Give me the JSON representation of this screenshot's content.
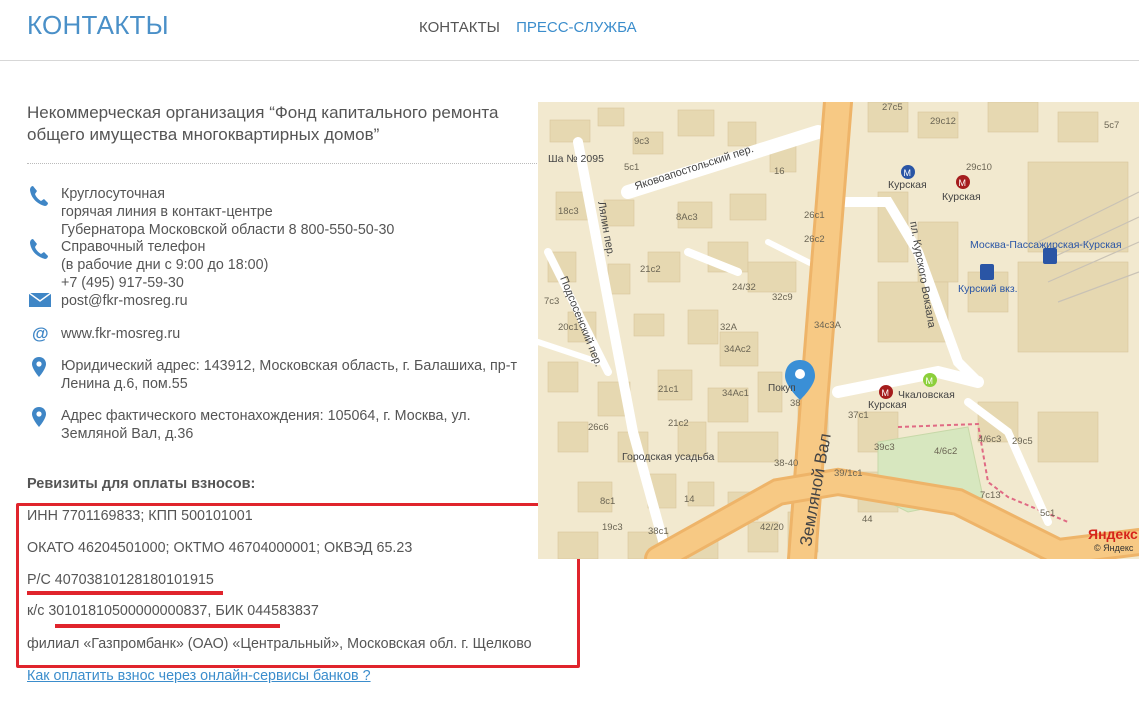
{
  "header": {
    "title": "КОНТАКТЫ",
    "nav": [
      "КОНТАКТЫ",
      "ПРЕСС-СЛУЖБА"
    ]
  },
  "organization": "Некоммерческая организация “Фонд капитального ремонта общего имущества многоквартирных домов”",
  "contacts": {
    "hotline": {
      "line1": "Круглосуточная",
      "line2": "горячая линия в контакт-центре",
      "line3": "Губернатора Московской области 8 800-550-50-30"
    },
    "reference": {
      "line1": "Справочный телефон",
      "line2": "(в рабочие дни с 9:00 до 18:00)",
      "line3": "+7 (495) 917-59-30"
    },
    "email": "post@fkr-mosreg.ru",
    "website": "www.fkr-mosreg.ru",
    "legal_address": "Юридический адрес: 143912, Московская область, г. Балашиха, пр-т Ленина д.6, пом.55",
    "actual_address": "Адрес фактического местонахождения: 105064, г. Москва, ул. Земляной Вал, д.36"
  },
  "requisites": {
    "title": "Ревизиты для оплаты взносов:",
    "inn": "ИНН 7701169833; КПП 500101001",
    "okato": "ОКАТО 46204501000; ОКТМО 46704000001; ОКВЭД 65.23",
    "rs": "Р/С 40703810128180101915",
    "ks": "к/с 30101810500000000837, БИК 044583837",
    "branch": "филиал «Газпромбанк» (ОАО) «Центральный», Московская обл. г. Щелково"
  },
  "pay_link": "Как оплатить взнос через онлайн-сервисы банков ?",
  "map": {
    "streets": {
      "zemlyanoy": "Земляной Вал",
      "yakovo": "Яковоапостольский пер.",
      "lyalin": "Лялин пер.",
      "podsosensky": "Подсосенский пер.",
      "kurskogo": "пл. Курского Вокзала"
    },
    "metro": {
      "kurskaya1": "Курская",
      "kurskaya2": "Курская",
      "kurskaya3": "Курская",
      "chkalovskaya": "Чкаловская"
    },
    "places": {
      "passenger": "Москва-Пассажирская-Курская",
      "kursky_vkz": "Курский вкз.",
      "usadba": "Городская усадьба",
      "school": "Ша № 2095",
      "pokr": "Покуп"
    },
    "houses": [
      "27с5",
      "29с12",
      "5с7",
      "9с3",
      "5с1",
      "29с10",
      "16",
      "18с3",
      "8Ас3",
      "26с1",
      "21с2",
      "24/32",
      "26с2",
      "32с9",
      "7с3",
      "20с1",
      "32А",
      "34с3А",
      "34Ас2",
      "21с1",
      "34Ас1",
      "38",
      "26с6",
      "21с2",
      "37с1",
      "39с3",
      "4/6с3",
      "29с5",
      "4/6с2",
      "38-40",
      "39/1с1",
      "8с1",
      "14",
      "7с13",
      "19с3",
      "38с1",
      "5с1",
      "42/20",
      "44"
    ],
    "logo": "Яндекс",
    "copyright": "© Яндекс"
  }
}
